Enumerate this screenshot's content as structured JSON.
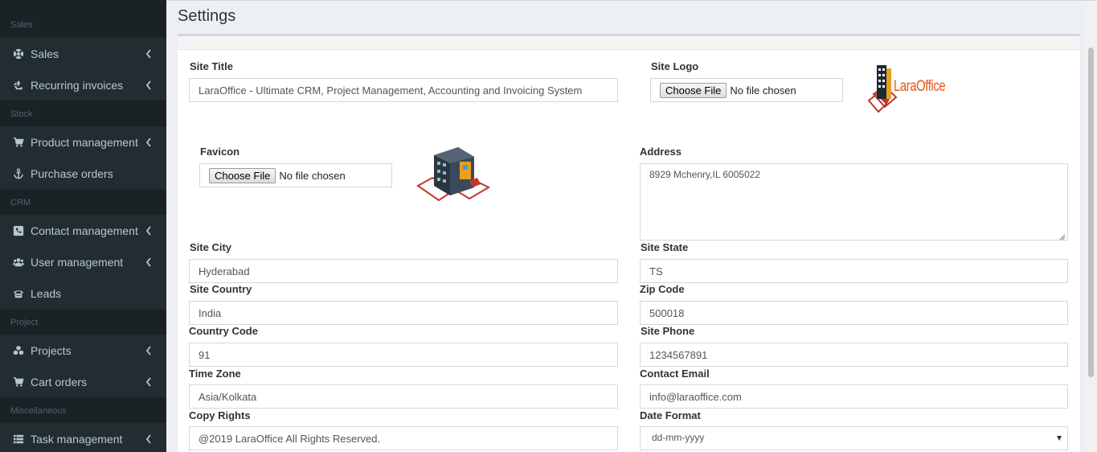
{
  "sidebar": {
    "sections": [
      {
        "header": "Sales",
        "items": [
          {
            "label": "Sales",
            "icon": "life-ring-icon",
            "chevron": true
          },
          {
            "label": "Recurring invoices",
            "icon": "recycle-icon",
            "chevron": true
          }
        ]
      },
      {
        "header": "Stock",
        "items": [
          {
            "label": "Product management",
            "icon": "cart-icon",
            "chevron": true
          },
          {
            "label": "Purchase orders",
            "icon": "anchor-icon",
            "chevron": false
          }
        ]
      },
      {
        "header": "CRM",
        "items": [
          {
            "label": "Contact management",
            "icon": "phone-icon",
            "chevron": true
          },
          {
            "label": "User management",
            "icon": "users-icon",
            "chevron": true
          },
          {
            "label": "Leads",
            "icon": "fax-icon",
            "chevron": false
          }
        ]
      },
      {
        "header": "Project",
        "items": [
          {
            "label": "Projects",
            "icon": "cubes-icon",
            "chevron": true
          },
          {
            "label": "Cart orders",
            "icon": "cart-icon",
            "chevron": true
          }
        ]
      },
      {
        "header": "Miscellaneous",
        "items": [
          {
            "label": "Task management",
            "icon": "list-icon",
            "chevron": true
          }
        ]
      }
    ]
  },
  "page": {
    "title": "Settings"
  },
  "form": {
    "site_title": {
      "label": "Site Title",
      "value": "LaraOffice - Ultimate CRM, Project Management, Accounting and Invoicing System"
    },
    "site_logo": {
      "label": "Site Logo",
      "button": "Choose File",
      "status": "No file chosen",
      "logo_text": "LaraOffice"
    },
    "favicon": {
      "label": "Favicon",
      "button": "Choose File",
      "status": "No file chosen"
    },
    "address": {
      "label": "Address",
      "value": "8929  Mchenry,IL 6005022"
    },
    "site_city": {
      "label": "Site City",
      "value": "Hyderabad"
    },
    "site_state": {
      "label": "Site State",
      "value": "TS"
    },
    "site_country": {
      "label": "Site Country",
      "value": "India"
    },
    "zip_code": {
      "label": "Zip Code",
      "value": "500018"
    },
    "country_code": {
      "label": "Country Code",
      "value": "91"
    },
    "site_phone": {
      "label": "Site Phone",
      "value": "1234567891"
    },
    "time_zone": {
      "label": "Time Zone",
      "value": "Asia/Kolkata"
    },
    "contact_email": {
      "label": "Contact Email",
      "value": "info@laraoffice.com"
    },
    "copy_rights": {
      "label": "Copy Rights",
      "value": "@2019 LaraOffice All Rights Reserved."
    },
    "date_format": {
      "label": "Date Format",
      "value": "dd-mm-yyyy"
    }
  },
  "colors": {
    "sidebar_bg": "#222d32",
    "sidebar_header_bg": "#1a2226",
    "sidebar_text": "#b8c7ce",
    "page_bg": "#ecf0f5",
    "logo_orange": "#e8541c"
  }
}
